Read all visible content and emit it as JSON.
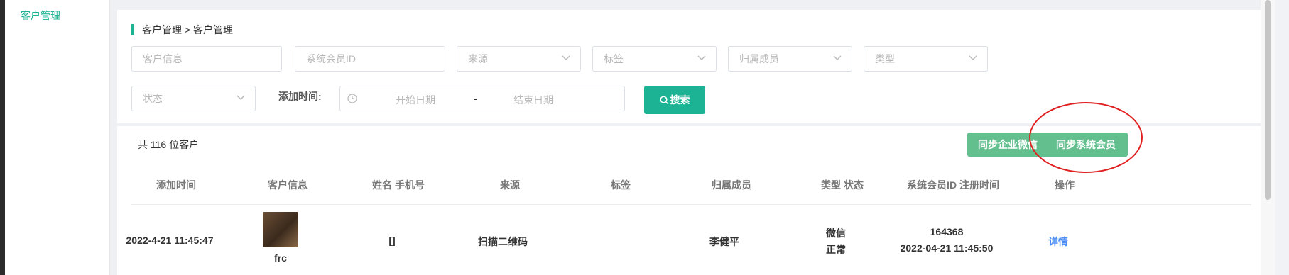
{
  "sidebar": {
    "items": [
      {
        "label": "客户管理"
      }
    ]
  },
  "breadcrumb": "客户管理 > 客户管理",
  "filters": {
    "customer_info": "客户信息",
    "system_member_id": "系统会员ID",
    "source": "来源",
    "tag": "标签",
    "owner": "归属成员",
    "type": "类型",
    "status": "状态",
    "add_time_label": "添加时间:",
    "start_date": "开始日期",
    "date_separator": "-",
    "end_date": "结束日期",
    "search_button": "搜索"
  },
  "summary": {
    "count_text": "共 116 位客户"
  },
  "actions": {
    "sync_wechat": "同步企业微信",
    "sync_member": "同步系统会员"
  },
  "table": {
    "headers": [
      "添加时间",
      "客户信息",
      "姓名 手机号",
      "来源",
      "标签",
      "归属成员",
      "类型 状态",
      "系统会员ID 注册时间",
      "操作"
    ],
    "rows": [
      {
        "add_time": "2022-4-21 11:45:47",
        "customer_name": "frc",
        "name_phone": "[]",
        "source": "扫描二维码",
        "tag": "",
        "owner": "李健平",
        "type": "微信",
        "status": "正常",
        "member_id": "164368",
        "register_time": "2022-04-21 11:45:50",
        "action": "详情"
      }
    ]
  },
  "colors": {
    "accent": "#1bb394",
    "sync_button": "#63c08e",
    "link": "#4f8ef7",
    "annotation": "#e02020"
  }
}
